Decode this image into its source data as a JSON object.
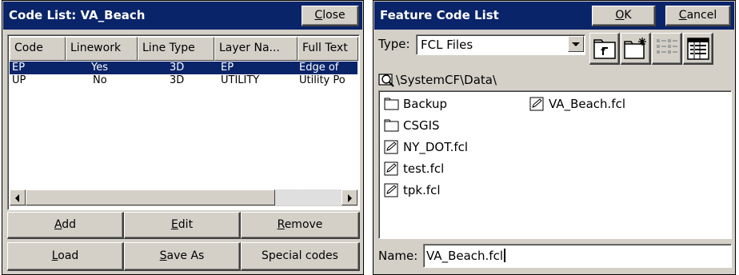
{
  "code_list": {
    "title": "Code List: VA_Beach",
    "close_label": "Close",
    "columns": [
      "Code",
      "Linework",
      "Line Type",
      "Layer Na...",
      "Full Text"
    ],
    "rows": [
      {
        "code": "EP",
        "linework": "Yes",
        "line_type": "3D",
        "layer": "EP",
        "full_text": "Edge of"
      },
      {
        "code": "UP",
        "linework": "No",
        "line_type": "3D",
        "layer": "UTILITY",
        "full_text": "Utility Po"
      }
    ],
    "buttons": {
      "add": "Add",
      "edit": "Edit",
      "remove": "Remove",
      "load": "Load",
      "save_as": "Save As",
      "special_codes": "Special codes"
    }
  },
  "feature_code_list": {
    "title": "Feature Code List",
    "ok_label": "OK",
    "cancel_label": "Cancel",
    "type_label": "Type:",
    "type_value": "FCL Files",
    "path": "\\SystemCF\\Data\\",
    "files_col1": [
      {
        "name": "Backup",
        "icon": "folder-icon"
      },
      {
        "name": "CSGIS",
        "icon": "folder-icon"
      },
      {
        "name": "NY_DOT.fcl",
        "icon": "fcl-file-icon"
      },
      {
        "name": "test.fcl",
        "icon": "fcl-file-icon"
      },
      {
        "name": "tpk.fcl",
        "icon": "fcl-file-icon"
      }
    ],
    "files_col2": [
      {
        "name": "VA_Beach.fcl",
        "icon": "fcl-file-icon"
      }
    ],
    "name_label": "Name:",
    "name_value": "VA_Beach.fcl"
  },
  "colors": {
    "titlebar": "#0a246a",
    "face": "#d4d0c8",
    "selection": "#0a246a"
  }
}
